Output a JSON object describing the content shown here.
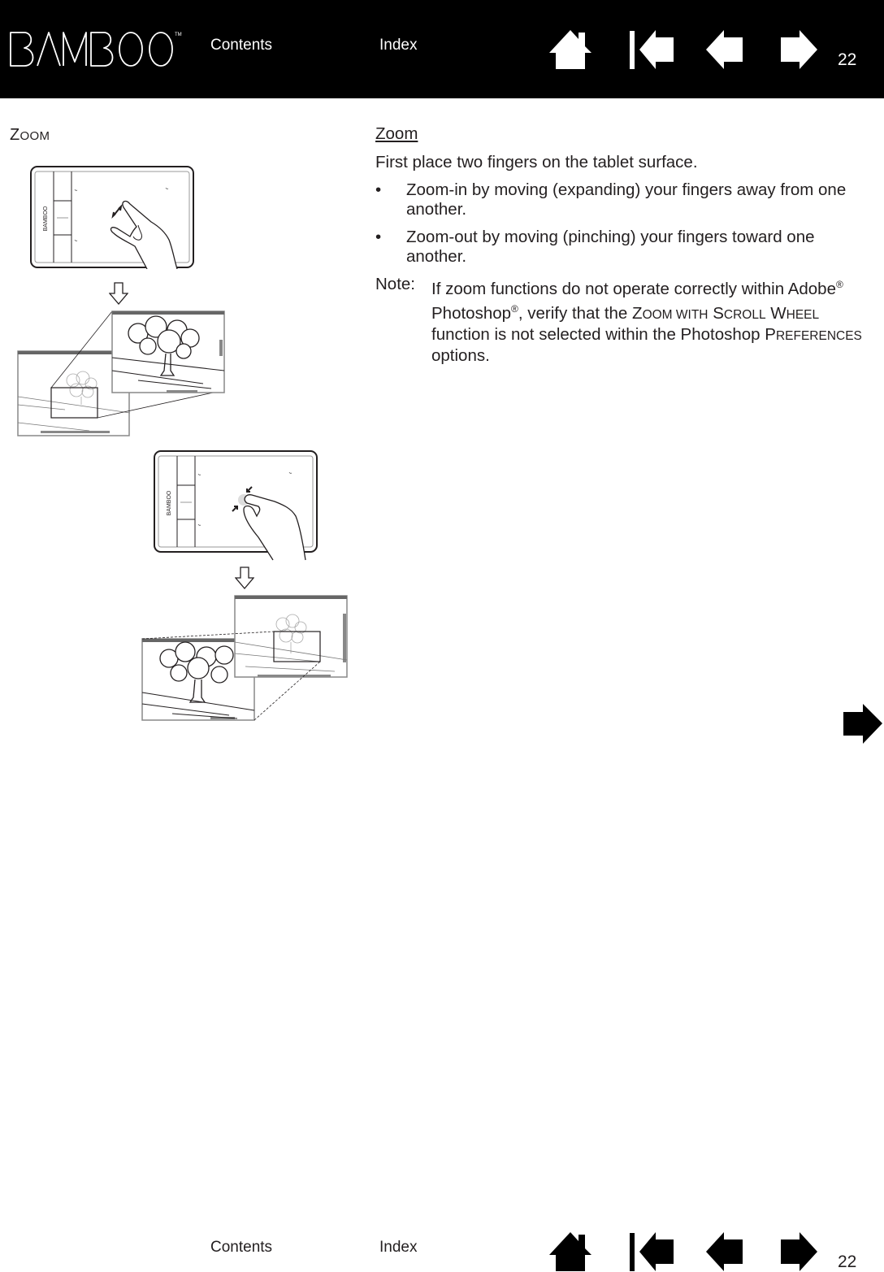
{
  "header": {
    "logo_text": "BAMBOO",
    "logo_trademark": "TM",
    "links": {
      "contents": "Contents",
      "index": "Index"
    },
    "nav_icons": [
      "home-icon",
      "first-page-icon",
      "previous-page-icon",
      "next-page-icon"
    ],
    "page_number": "22"
  },
  "section": {
    "heading_initial": "Z",
    "heading_rest": "OOM"
  },
  "content": {
    "subheading": "Zoom",
    "intro": "First place two fingers on the tablet surface.",
    "bullets": [
      {
        "marker": "•",
        "text": "Zoom-in by moving (expanding) your fingers away from one another."
      },
      {
        "marker": "•",
        "text": "Zoom-out by moving (pinching) your fingers toward one another."
      }
    ],
    "note": {
      "label": "Note:",
      "part1": "If zoom functions do not operate correctly within Adobe",
      "reg1": "®",
      "part2": " Photoshop",
      "reg2": "®",
      "part3": ", verify that the ",
      "sc1_initial": "Z",
      "sc1_rest": "OOM WITH",
      "sc2_initial": "S",
      "sc2_rest": "CROLL",
      "sc3_initial": "W",
      "sc3_rest": "HEEL",
      "part4": " function is not selected within the Photoshop ",
      "sc4_initial": "P",
      "sc4_rest": "REFERENCES",
      "part5": " options."
    }
  },
  "illustrations": {
    "tablet_brand": "BAMBOO",
    "zoom_in_caption": "zoom-in gesture (fingers spreading)",
    "zoom_out_caption": "zoom-out gesture (fingers pinching)"
  },
  "footer": {
    "links": {
      "contents": "Contents",
      "index": "Index"
    },
    "nav_icons": [
      "home-icon",
      "first-page-icon",
      "previous-page-icon",
      "next-page-icon"
    ],
    "page_number": "22"
  },
  "colors": {
    "header_bg": "#000000",
    "text": "#231f20",
    "header_text": "#ffffff"
  }
}
